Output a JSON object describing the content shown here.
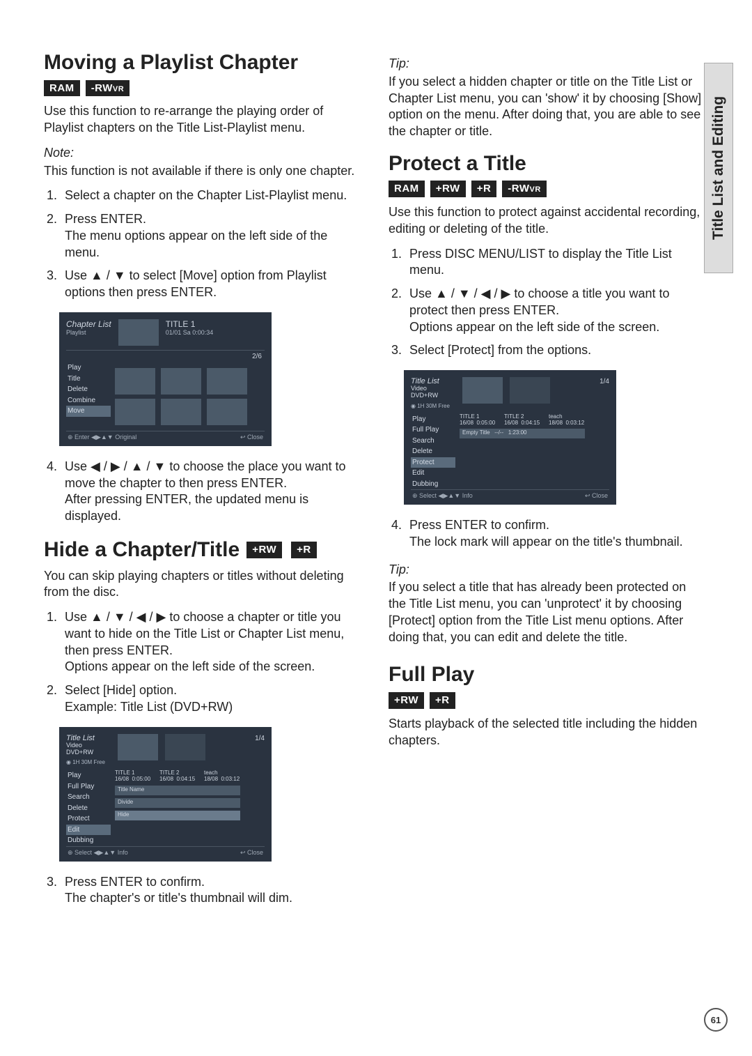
{
  "sidebar": {
    "label": "Title List and Editing"
  },
  "page_number": "61",
  "badges": {
    "ram": "RAM",
    "rwvr": "-RWVR",
    "prw": "+RW",
    "pr": "+R"
  },
  "left": {
    "moving": {
      "title": "Moving a Playlist Chapter",
      "intro": "Use this function to re-arrange the playing order of Playlist chapters on the Title List-Playlist menu.",
      "note_label": "Note:",
      "note_body": "This function is not available if there is only one chapter.",
      "steps": {
        "s1": "Select a chapter on the Chapter List-Playlist menu.",
        "s2a": "Press ENTER.",
        "s2b": "The menu options appear on the left side of the menu.",
        "s3": "Use ▲ / ▼ to select [Move] option from Playlist options then press ENTER.",
        "s4a": "Use ◀ / ▶ / ▲ / ▼ to choose the place you want to move the chapter to then press ENTER.",
        "s4b": "After pressing ENTER, the updated menu is displayed."
      },
      "screenshot": {
        "header_title": "Chapter List",
        "header_sub1": "Playlist",
        "info_title": "TITLE 1",
        "info_line": "01/01  Sa  0:00:34",
        "page": "2/6",
        "menu": [
          "Play",
          "Title",
          "Delete",
          "Combine",
          "Move"
        ],
        "foot_left": "⊕ Enter  ◀▶▲▼ Original",
        "foot_right": "↩ Close"
      }
    },
    "hide": {
      "title": "Hide a Chapter/Title",
      "intro": "You can skip playing chapters or titles without deleting from the disc.",
      "steps": {
        "s1a": "Use ▲ / ▼ / ◀ / ▶ to choose a chapter or title you want to hide on the Title List or Chapter List menu, then press ENTER.",
        "s1b": "Options appear on the left side of the screen.",
        "s2a": "Select [Hide] option.",
        "s2b": "Example: Title List (DVD+RW)",
        "s3a": "Press ENTER to confirm.",
        "s3b": "The chapter's or title's thumbnail will dim."
      },
      "screenshot": {
        "header_title": "Title List",
        "header_sub1": "Video",
        "header_sub2": "DVD+RW",
        "cap_line": "1H 30M Free",
        "page": "1/4",
        "tiles": [
          {
            "t": "TITLE 1",
            "d": "16/08",
            "len": "0:05:00"
          },
          {
            "t": "TITLE 2",
            "d": "16/08",
            "len": "0:04:15"
          },
          {
            "t": "teach",
            "d": "18/08",
            "len": "0:03:12"
          }
        ],
        "menu": [
          "Play",
          "Full Play",
          "Search",
          "Delete",
          "Protect",
          "Edit",
          "Dubbing"
        ],
        "submenu": [
          "Title Name",
          "Divide",
          "Hide"
        ],
        "foot_left": "⊕ Select  ◀▶▲▼ Info",
        "foot_right": "↩ Close"
      }
    }
  },
  "right": {
    "tip1": {
      "label": "Tip:",
      "body": "If you select a hidden chapter or title on the Title List or Chapter List menu, you can 'show' it by choosing [Show] option on the menu. After doing that, you are able to see the chapter or title."
    },
    "protect": {
      "title": "Protect a Title",
      "intro": "Use this function to protect against accidental recording, editing or deleting of the title.",
      "steps": {
        "s1": "Press DISC MENU/LIST to display the Title List menu.",
        "s2a": "Use ▲ / ▼ / ◀ / ▶ to choose a title you want to protect then press ENTER.",
        "s2b": "Options appear on the left side of the screen.",
        "s3": "Select [Protect] from the options.",
        "s4a": "Press ENTER to confirm.",
        "s4b": "The lock mark will appear on the title's thumbnail."
      },
      "screenshot": {
        "header_title": "Title List",
        "header_sub1": "Video",
        "header_sub2": "DVD+RW",
        "cap_line": "1H 30M Free",
        "page": "1/4",
        "tiles": [
          {
            "t": "TITLE 1",
            "d": "16/08",
            "len": "0:05:00"
          },
          {
            "t": "TITLE 2",
            "d": "16/08",
            "len": "0:04:15"
          },
          {
            "t": "teach",
            "d": "18/08",
            "len": "0:03:12"
          }
        ],
        "empty": {
          "t": "Empty Title",
          "d": "--/--",
          "len": "1:23:00"
        },
        "menu": [
          "Play",
          "Full Play",
          "Search",
          "Delete",
          "Protect",
          "Edit",
          "Dubbing"
        ],
        "foot_left": "⊕ Select  ◀▶▲▼ Info",
        "foot_right": "↩ Close"
      }
    },
    "tip2": {
      "label": "Tip:",
      "body": "If you select a title that has already been protected on the Title List menu, you can 'unprotect' it by choosing [Protect] option from the Title List menu options. After doing that, you can edit and delete the title."
    },
    "fullplay": {
      "title": "Full Play",
      "body": "Starts playback of the selected title including the hidden chapters."
    }
  }
}
